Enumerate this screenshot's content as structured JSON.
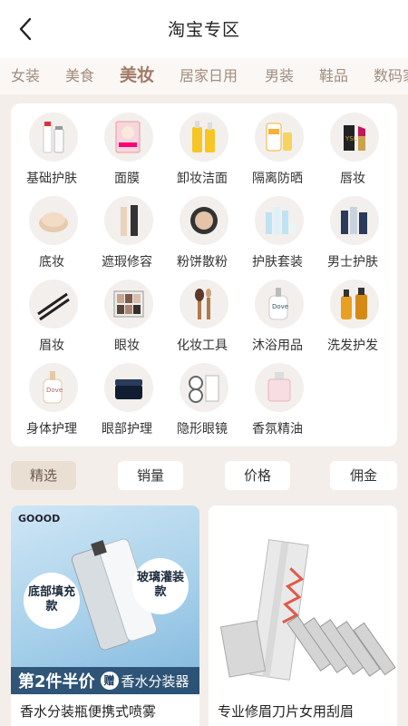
{
  "header": {
    "title": "淘宝专区"
  },
  "category_tabs": [
    {
      "label": "女装",
      "active": false
    },
    {
      "label": "美食",
      "active": false
    },
    {
      "label": "美妆",
      "active": true
    },
    {
      "label": "居家日用",
      "active": false
    },
    {
      "label": "男装",
      "active": false
    },
    {
      "label": "鞋品",
      "active": false
    },
    {
      "label": "数码家",
      "active": false
    }
  ],
  "subcategories": [
    {
      "label": "基础护肤",
      "icon": "skincare-bottles-icon"
    },
    {
      "label": "面膜",
      "icon": "face-mask-icon"
    },
    {
      "label": "卸妆洁面",
      "icon": "cleanser-bottles-icon"
    },
    {
      "label": "隔离防晒",
      "icon": "sunscreen-icon"
    },
    {
      "label": "唇妆",
      "icon": "lipstick-icon"
    },
    {
      "label": "底妆",
      "icon": "cushion-compact-icon"
    },
    {
      "label": "遮瑕修容",
      "icon": "concealer-icon"
    },
    {
      "label": "粉饼散粉",
      "icon": "powder-compact-icon"
    },
    {
      "label": "护肤套装",
      "icon": "skincare-set-icon"
    },
    {
      "label": "男士护肤",
      "icon": "mens-skincare-icon"
    },
    {
      "label": "眉妆",
      "icon": "eyebrow-pencil-icon"
    },
    {
      "label": "眼妆",
      "icon": "eyeshadow-palette-icon"
    },
    {
      "label": "化妆工具",
      "icon": "makeup-brush-icon"
    },
    {
      "label": "沐浴用品",
      "icon": "body-wash-icon"
    },
    {
      "label": "洗发护发",
      "icon": "shampoo-icon"
    },
    {
      "label": "身体护理",
      "icon": "body-lotion-icon"
    },
    {
      "label": "眼部护理",
      "icon": "eye-cream-icon"
    },
    {
      "label": "隐形眼镜",
      "icon": "contact-lens-icon"
    },
    {
      "label": "香氛精油",
      "icon": "perfume-icon"
    }
  ],
  "sort_options": [
    {
      "label": "精选",
      "active": true
    },
    {
      "label": "销量",
      "active": false
    },
    {
      "label": "价格",
      "active": false
    },
    {
      "label": "佣金",
      "active": false
    }
  ],
  "products": [
    {
      "name": "香水分装瓶便携式喷雾",
      "image": "perfume-atomizer-image",
      "brand": "GOOOD",
      "bubble_left": "底部填充款",
      "bubble_right": "玻璃灌装款",
      "promo_main": "第2件半价",
      "promo_gift": "赠",
      "promo_rest": "香水分装器"
    },
    {
      "name": "专业修眉刀片女用刮眉",
      "image": "eyebrow-razor-image"
    }
  ],
  "colors": {
    "background": "#f4eeea",
    "active_tab": "#a07a66",
    "inactive_tab": "#a08e80",
    "active_sort_bg": "#e9dfd3",
    "promo_banner": "#193c5f"
  }
}
